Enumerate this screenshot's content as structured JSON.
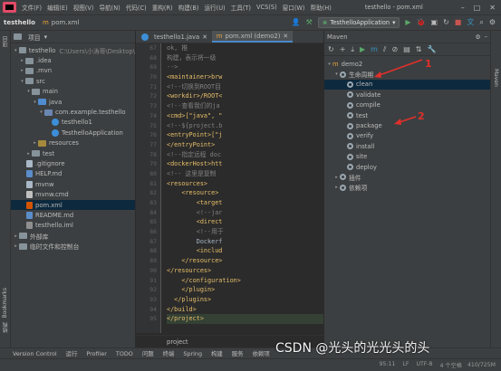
{
  "menubar": {
    "items": [
      "文件(F)",
      "编辑(E)",
      "视图(V)",
      "导航(N)",
      "代码(C)",
      "重构(R)",
      "构建(B)",
      "运行(U)",
      "工具(T)",
      "VCS(S)",
      "窗口(W)",
      "帮助(H)"
    ],
    "window_title": "testhello - pom.xml"
  },
  "navbar": {
    "project": "testhello",
    "file": "pom.xml",
    "run_config": "TesthelloApplication"
  },
  "project_panel": {
    "title": "项目",
    "tree": [
      {
        "label": "testhello",
        "hint": "C:\\Users\\小涛哥\\Desktop\\",
        "indent": 0,
        "arrow": "▾",
        "icon": "folder"
      },
      {
        "label": ".idea",
        "indent": 1,
        "arrow": "▸",
        "icon": "folder"
      },
      {
        "label": ".mvn",
        "indent": 1,
        "arrow": "▸",
        "icon": "folder"
      },
      {
        "label": "src",
        "indent": 1,
        "arrow": "▾",
        "icon": "folder"
      },
      {
        "label": "main",
        "indent": 2,
        "arrow": "▾",
        "icon": "folder"
      },
      {
        "label": "java",
        "indent": 3,
        "arrow": "▾",
        "icon": "folder java"
      },
      {
        "label": "com.example.testhello",
        "indent": 4,
        "arrow": "▾",
        "icon": "folder src"
      },
      {
        "label": "testhello1",
        "indent": 5,
        "arrow": "",
        "icon": "file c"
      },
      {
        "label": "TesthelloApplication",
        "indent": 5,
        "arrow": "",
        "icon": "file c"
      },
      {
        "label": "resources",
        "indent": 3,
        "arrow": "▸",
        "icon": "folder res"
      },
      {
        "label": "test",
        "indent": 2,
        "arrow": "▸",
        "icon": "folder"
      },
      {
        "label": ".gitignore",
        "indent": 1,
        "arrow": "",
        "icon": "file"
      },
      {
        "label": "HELP.md",
        "indent": 1,
        "arrow": "",
        "icon": "file md"
      },
      {
        "label": "mvnw",
        "indent": 1,
        "arrow": "",
        "icon": "file"
      },
      {
        "label": "mvnw.cmd",
        "indent": 1,
        "arrow": "",
        "icon": "file cmd"
      },
      {
        "label": "pom.xml",
        "indent": 1,
        "arrow": "",
        "icon": "file m",
        "selected": true
      },
      {
        "label": "README.md",
        "indent": 1,
        "arrow": "",
        "icon": "file md"
      },
      {
        "label": "testhello.iml",
        "indent": 1,
        "arrow": "",
        "icon": "file iml"
      },
      {
        "label": "外部库",
        "indent": 0,
        "arrow": "▸",
        "icon": "folder"
      },
      {
        "label": "临时文件和控制台",
        "indent": 0,
        "arrow": "▸",
        "icon": "folder"
      }
    ]
  },
  "editor": {
    "tabs": [
      {
        "label": "testhello1.java",
        "active": false
      },
      {
        "label": "pom.xml (demo2)",
        "active": true
      }
    ],
    "line_numbers": [
      "67",
      "68",
      "69",
      "70",
      "71",
      "72",
      "73",
      "74",
      "75",
      "76",
      "77",
      "78",
      "79",
      "80",
      "81",
      "82",
      "83",
      "84",
      "85",
      "86",
      "87",
      "88",
      "89",
      "90",
      "91",
      "92",
      "93",
      "94",
      "95"
    ],
    "lines": [
      {
        "text": "ok, 推",
        "kind": "cm"
      },
      {
        "text": "构建，表示将一级",
        "kind": "cm"
      },
      {
        "text": "-->",
        "kind": "cm"
      },
      {
        "text": "<maintainer>brw",
        "kind": "tag"
      },
      {
        "text": "<!--切换到ROOT目",
        "kind": "cm"
      },
      {
        "text": "<workdir>/ROOT<",
        "kind": "tag"
      },
      {
        "text": "<!--查看我们的ja",
        "kind": "cm"
      },
      {
        "text": "<cmd>[\"java\", \"",
        "kind": "tag"
      },
      {
        "text": "<!--${project.b",
        "kind": "cm"
      },
      {
        "text": "<entryPoint>[\"j",
        "kind": "tag"
      },
      {
        "text": "</entryPoint>",
        "kind": "tag"
      },
      {
        "text": "<!--指定远程 doc",
        "kind": "cm"
      },
      {
        "text": "<dockerHost>htt",
        "kind": "tag"
      },
      {
        "text": "<!-- 这里是复制 ",
        "kind": "cm"
      },
      {
        "text": "<resources>",
        "kind": "tag"
      },
      {
        "text": "    <resource>",
        "kind": "tag"
      },
      {
        "text": "        <target",
        "kind": "tag"
      },
      {
        "text": "        <!--jar",
        "kind": "cm"
      },
      {
        "text": "        <direct",
        "kind": "tag"
      },
      {
        "text": "        <!--用于",
        "kind": "cm"
      },
      {
        "text": "        Dockerf",
        "kind": "plain"
      },
      {
        "text": "        <includ",
        "kind": "tag"
      },
      {
        "text": "    </resource>",
        "kind": "tag"
      },
      {
        "text": "</resources>",
        "kind": "tag"
      },
      {
        "text": "    </configuration>",
        "kind": "tag"
      },
      {
        "text": "    </plugin>",
        "kind": "tag"
      },
      {
        "text": "  </plugins>",
        "kind": "tag"
      },
      {
        "text": "</build>",
        "kind": "tag"
      },
      {
        "text": "</project>",
        "kind": "tag",
        "highlight": true
      }
    ],
    "footer": "project"
  },
  "maven": {
    "title": "Maven",
    "root": "demo2",
    "lifecycle_label": "生命周期",
    "phases": [
      "clean",
      "validate",
      "compile",
      "test",
      "package",
      "verify",
      "install",
      "site",
      "deploy"
    ],
    "selected_phase": "clean",
    "plugins_label": "插件",
    "deps_label": "依赖项",
    "side_label": "Maven"
  },
  "annotations": [
    "1",
    "2"
  ],
  "bottom_tools": [
    "Version Control",
    "运行",
    "Profiler",
    "TODO",
    "问题",
    "终端",
    "Spring",
    "构建",
    "服务",
    "依赖项"
  ],
  "statusbar": {
    "right": [
      "95:11",
      "LF",
      "UTF-8",
      "4 个空格"
    ],
    "memory": "410/725M"
  },
  "side_labels": {
    "project": "项目",
    "bookmarks": "Bookmarks",
    "structure": "结构"
  },
  "watermark": "CSDN @光头的光光头的头"
}
